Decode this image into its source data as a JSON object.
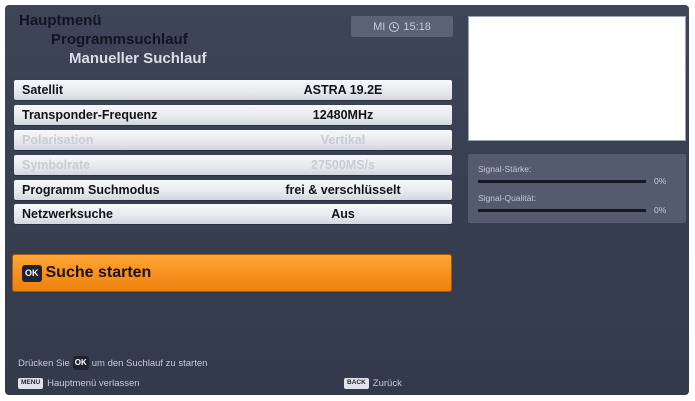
{
  "breadcrumb": [
    "Hauptmenü",
    "Programmsuchlauf",
    "Manueller Suchlauf"
  ],
  "clock": {
    "day": "MI",
    "time": "15:18"
  },
  "settings": [
    {
      "label": "Satellit",
      "value": "ASTRA 19.2E",
      "enabled": true
    },
    {
      "label": "Transponder-Frequenz",
      "value": "12480MHz",
      "enabled": true
    },
    {
      "label": "Polarisation",
      "value": "Vertikal",
      "enabled": false
    },
    {
      "label": "Symbolrate",
      "value": "27500MS/s",
      "enabled": false
    },
    {
      "label": "Programm Suchmodus",
      "value": "frei & verschlüsselt",
      "enabled": true
    },
    {
      "label": "Netzwerksuche",
      "value": "Aus",
      "enabled": true
    }
  ],
  "start_button": {
    "key": "OK",
    "label": "Suche starten"
  },
  "signal": {
    "strength_label": "Signal-Stärke:",
    "strength_value": "0%",
    "strength_fraction": 0,
    "quality_label": "Signal-Qualität:",
    "quality_value": "0%",
    "quality_fraction": 0
  },
  "hint": {
    "before": "Drücken Sie",
    "key": "OK",
    "after": "um den Suchlauf zu starten"
  },
  "footer": {
    "menu_key": "MENU",
    "menu_label": "Hauptmenü verlassen",
    "back_key": "BACK",
    "back_label": "Zurück"
  },
  "colors": {
    "accent": "#f6901c",
    "background": "#3a4254",
    "row": "#e6e8ec"
  }
}
